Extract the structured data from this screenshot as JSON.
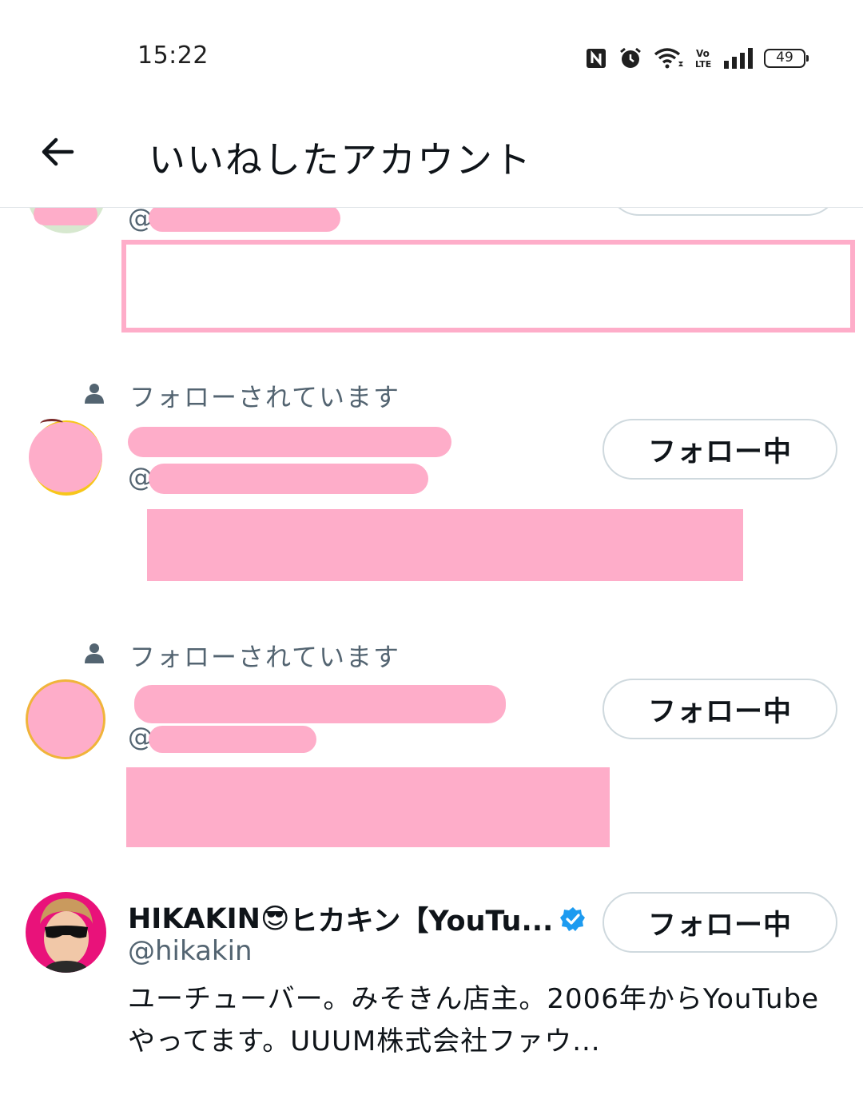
{
  "status_bar": {
    "time": "15:22",
    "battery": "49",
    "network_label": "Vo LTE"
  },
  "header": {
    "title": "いいねしたアカウント",
    "back_icon": "arrow-left-icon"
  },
  "users": [
    {
      "at": "@",
      "redacted": true
    },
    {
      "followed_label": "フォローされています",
      "at": "@",
      "follow_button": "フォロー中",
      "redacted": true
    },
    {
      "followed_label": "フォローされています",
      "at": "@",
      "follow_button": "フォロー中",
      "redacted": true
    },
    {
      "name_prefix": "HIKAKIN",
      "name_emoji": "😎",
      "name_suffix": "ヒカキン【YouTu...",
      "verified_icon": "verified-badge-icon",
      "handle": "@hikakin",
      "bio": "ユーチューバー。みそきん店主。2006年からYouTubeやってます。UUUM株式会社ファウ...",
      "follow_button": "フォロー中"
    }
  ],
  "colors": {
    "redaction": "#feadc9",
    "verified": "#1d9bf0",
    "secondary_text": "#536471",
    "button_border": "#cfd9de"
  }
}
